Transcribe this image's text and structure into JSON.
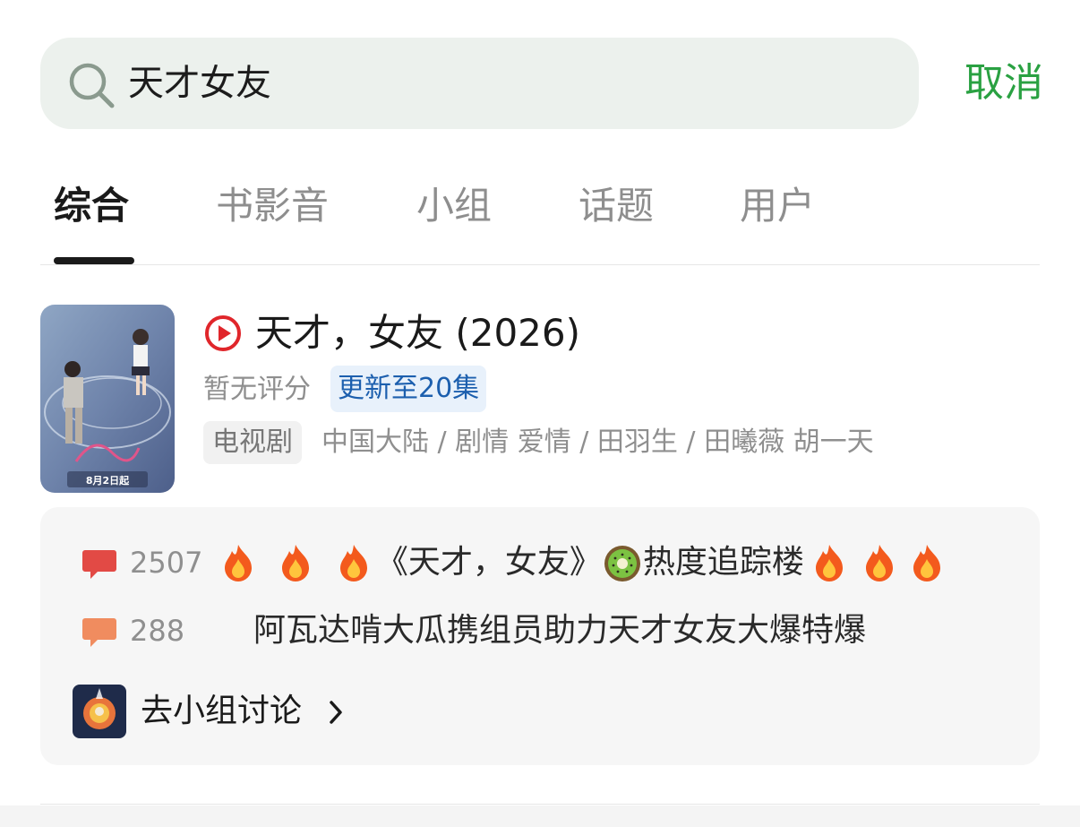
{
  "search": {
    "query": "天才女友",
    "cancel_label": "取消"
  },
  "tabs": [
    {
      "label": "综合",
      "active": true
    },
    {
      "label": "书影音",
      "active": false
    },
    {
      "label": "小组",
      "active": false
    },
    {
      "label": "话题",
      "active": false
    },
    {
      "label": "用户",
      "active": false
    }
  ],
  "result": {
    "poster_caption": "8月2日起",
    "title": "天才，女友 (2026)",
    "rating": "暂无评分",
    "update_badge": "更新至20集",
    "type_badge": "电视剧",
    "meta": "中国大陆 / 剧情 爱情 / 田羽生 / 田曦薇 胡一天"
  },
  "group": {
    "topics": [
      {
        "count": "2507",
        "title": "《天才，女友》",
        "title_suffix": "热度追踪楼",
        "color": "#e24a45"
      },
      {
        "count": "288",
        "title": "阿瓦达啃大瓜携组员助力天才女友大爆特爆",
        "color": "#f08c5f"
      }
    ],
    "link_label": "去小组讨论"
  },
  "colors": {
    "accent_green": "#2aa142",
    "badge_blue": "#1c5fae",
    "play_red": "#e0262b"
  }
}
